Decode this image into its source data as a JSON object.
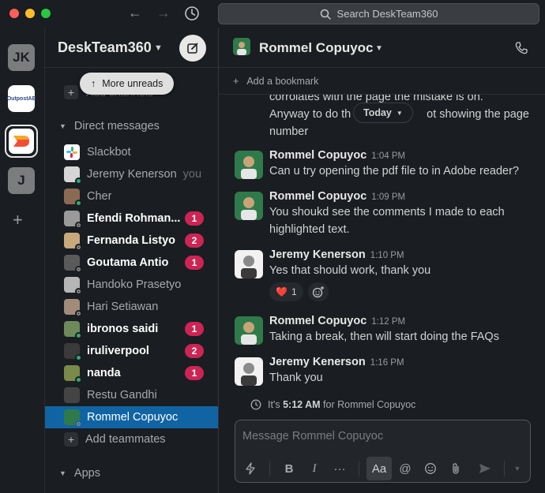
{
  "search": {
    "placeholder": "Search DeskTeam360"
  },
  "rail": {
    "workspaces": [
      {
        "label": "JK"
      },
      {
        "label": "OutpostAE"
      },
      {
        "label": ""
      },
      {
        "label": "J"
      }
    ],
    "add": "+"
  },
  "sidebar": {
    "workspace_name": "DeskTeam360",
    "more_unreads": "More unreads",
    "add_channels": "Add channels",
    "direct_messages": "Direct messages",
    "apps": "Apps",
    "add_teammates": "Add teammates",
    "dms": [
      {
        "name": "Slackbot",
        "unread": false,
        "badge": ""
      },
      {
        "name": "Jeremy Kenerson",
        "you": "you",
        "unread": false,
        "badge": ""
      },
      {
        "name": "Cher",
        "unread": false,
        "badge": ""
      },
      {
        "name": "Efendi Rohman...",
        "unread": true,
        "badge": "1"
      },
      {
        "name": "Fernanda Listyo",
        "unread": true,
        "badge": "2"
      },
      {
        "name": "Goutama Antio",
        "unread": true,
        "badge": "1"
      },
      {
        "name": "Handoko Prasetyo",
        "unread": false,
        "badge": ""
      },
      {
        "name": "Hari Setiawan",
        "unread": false,
        "badge": ""
      },
      {
        "name": "ibronos saidi",
        "unread": true,
        "badge": "1"
      },
      {
        "name": "iruliverpool",
        "unread": true,
        "badge": "2"
      },
      {
        "name": "nanda",
        "unread": true,
        "badge": "1"
      },
      {
        "name": "Restu Gandhi",
        "unread": false,
        "badge": ""
      },
      {
        "name": "Rommel Copuyoc",
        "unread": false,
        "badge": "",
        "active": true
      }
    ]
  },
  "channel": {
    "name": "Rommel Copuyoc",
    "add_bookmark": "Add a bookmark",
    "today": "Today",
    "continued_text": "corrolates with the page the mistake is on. Anyway to do th...ot showing the page number",
    "continued_line1": "corrolates with the page the mistake is on.",
    "continued_line2a": "Anyway to do th",
    "continued_line2b": "ot showing the page",
    "continued_line3": "number",
    "messages": [
      {
        "sender": "Rommel Copuyoc",
        "time": "1:04 PM",
        "text": "Can u try opening the pdf file to in Adobe reader?"
      },
      {
        "sender": "Rommel Copuyoc",
        "time": "1:09 PM",
        "text": "You shoukd see the comments I made to each highlighted text."
      },
      {
        "sender": "Jeremy Kenerson",
        "time": "1:10 PM",
        "text": "Yes that should work, thank you",
        "reaction": {
          "emoji": "❤️",
          "count": "1"
        }
      },
      {
        "sender": "Rommel Copuyoc",
        "time": "1:12 PM",
        "text": "Taking a break, then will start doing the FAQs"
      },
      {
        "sender": "Jeremy Kenerson",
        "time": "1:16 PM",
        "text": "Thank you"
      }
    ],
    "local_time_prefix": "It's",
    "local_time": "5:12 AM",
    "local_time_suffix": "for Rommel Copuyoc"
  },
  "composer": {
    "placeholder": "Message Rommel Copuyoc",
    "bold": "B",
    "italic": "I",
    "more": "···",
    "aa": "Aa",
    "mention": "@"
  },
  "colors": {
    "active_item": "#1164a3",
    "badge": "#cd2553",
    "online": "#2bac76"
  }
}
